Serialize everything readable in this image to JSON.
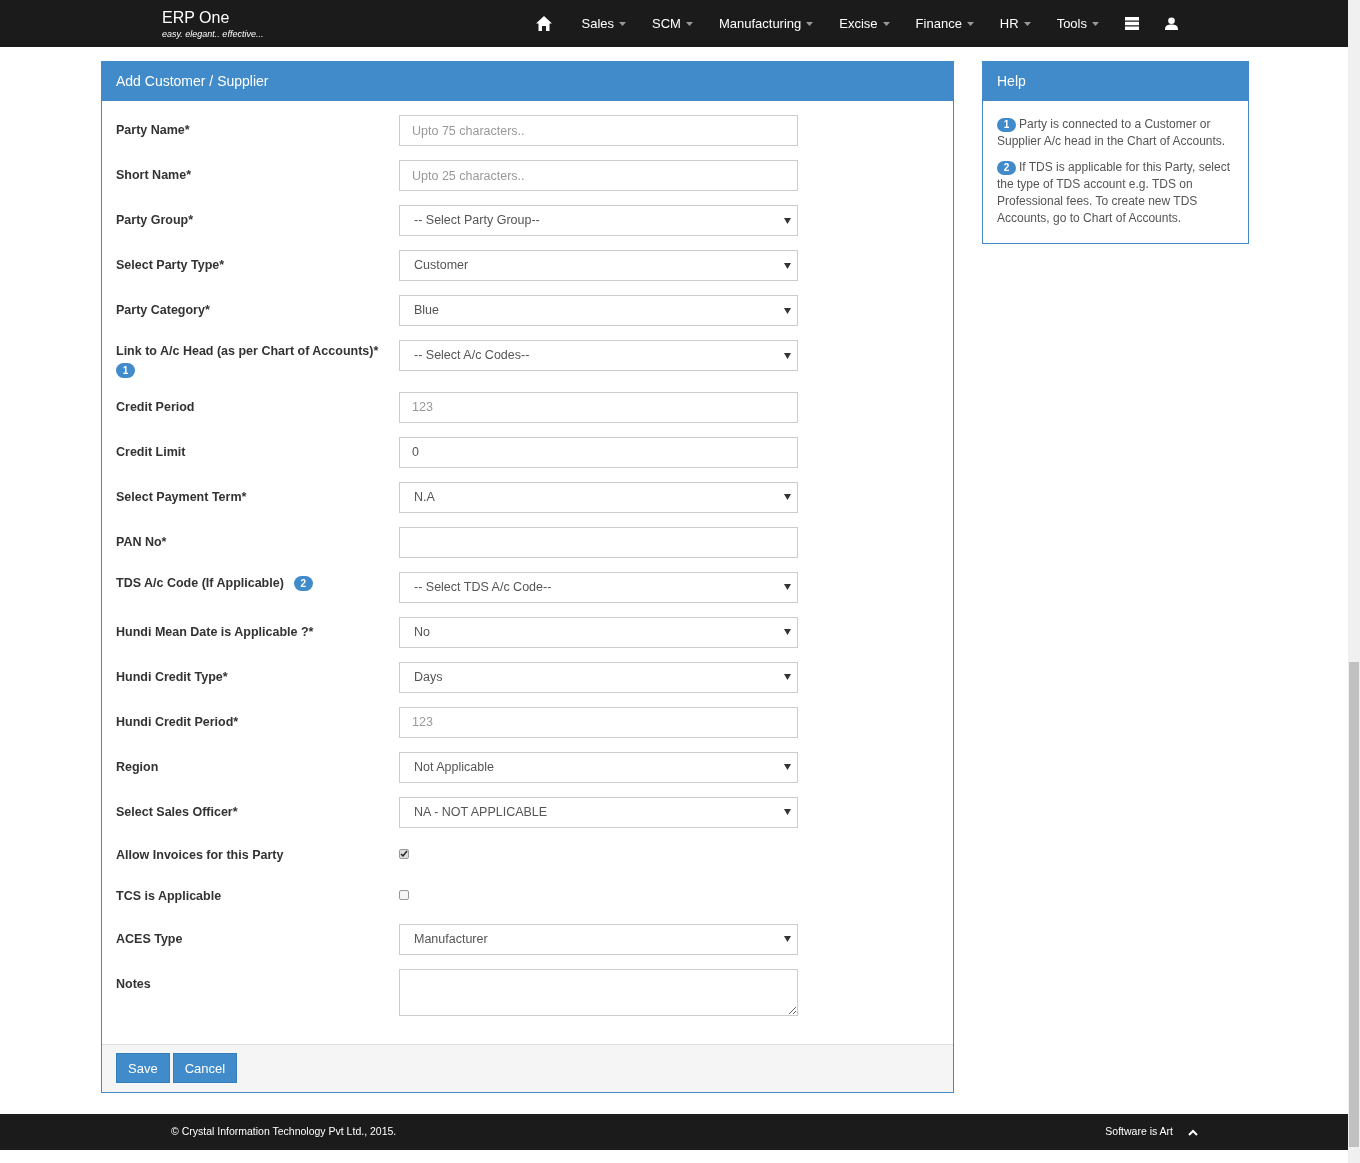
{
  "navbar": {
    "brand": "ERP One",
    "tagline": "easy. elegant.. effective...",
    "menus": [
      {
        "label": "Sales"
      },
      {
        "label": "SCM"
      },
      {
        "label": "Manufacturing"
      },
      {
        "label": "Excise"
      },
      {
        "label": "Finance"
      },
      {
        "label": "HR"
      },
      {
        "label": "Tools"
      }
    ]
  },
  "form": {
    "title": "Add Customer / Supplier",
    "fields": [
      {
        "label": "Party Name*",
        "kind": "text",
        "placeholder": "Upto 75 characters.."
      },
      {
        "label": "Short Name*",
        "kind": "text",
        "placeholder": "Upto 25 characters.."
      },
      {
        "label": "Party Group*",
        "kind": "select",
        "value": "-- Select Party Group--"
      },
      {
        "label": "Select Party Type*",
        "kind": "select",
        "value": "Customer"
      },
      {
        "label": "Party Category*",
        "kind": "select",
        "value": "Blue"
      },
      {
        "label": "Link to A/c Head (as per Chart of Accounts)*",
        "badge": "1",
        "kind": "select",
        "value": "-- Select A/c Codes--"
      },
      {
        "label": "Credit Period",
        "kind": "text",
        "placeholder": "123"
      },
      {
        "label": "Credit Limit",
        "kind": "text",
        "value": "0"
      },
      {
        "label": "Select Payment Term*",
        "kind": "select",
        "value": "N.A"
      },
      {
        "label": "PAN No*",
        "kind": "text"
      },
      {
        "label": "TDS A/c Code (If Applicable)",
        "badge": "2",
        "kind": "select",
        "value": "-- Select TDS A/c Code--"
      },
      {
        "label": "Hundi Mean Date is Applicable ?*",
        "kind": "select",
        "value": "No"
      },
      {
        "label": "Hundi Credit Type*",
        "kind": "select",
        "value": "Days"
      },
      {
        "label": "Hundi Credit Period*",
        "kind": "text",
        "placeholder": "123"
      },
      {
        "label": "Region",
        "kind": "select",
        "value": "Not Applicable"
      },
      {
        "label": "Select Sales Officer*",
        "kind": "select",
        "value": "NA - NOT APPLICABLE"
      },
      {
        "label": "Allow Invoices for this Party",
        "kind": "checkbox",
        "checked": true
      },
      {
        "label": "TCS is Applicable",
        "kind": "checkbox",
        "checked": false
      },
      {
        "label": "ACES Type",
        "kind": "select",
        "value": "Manufacturer"
      },
      {
        "label": "Notes",
        "kind": "textarea"
      }
    ],
    "buttons": [
      "Save",
      "Cancel"
    ]
  },
  "help": {
    "title": "Help",
    "items": [
      {
        "badge": "1",
        "text": "Party is connected to a Customer or Supplier A/c head in the Chart of Accounts."
      },
      {
        "badge": "2",
        "text": "If TDS is applicable for this Party, select the type of TDS account e.g. TDS on Professional fees. To create new TDS Accounts, go to Chart of Accounts."
      }
    ]
  },
  "footer": {
    "copyright": "© Crystal Information Technology Pvt Ltd., 2015.",
    "tagline": "Software is Art"
  }
}
